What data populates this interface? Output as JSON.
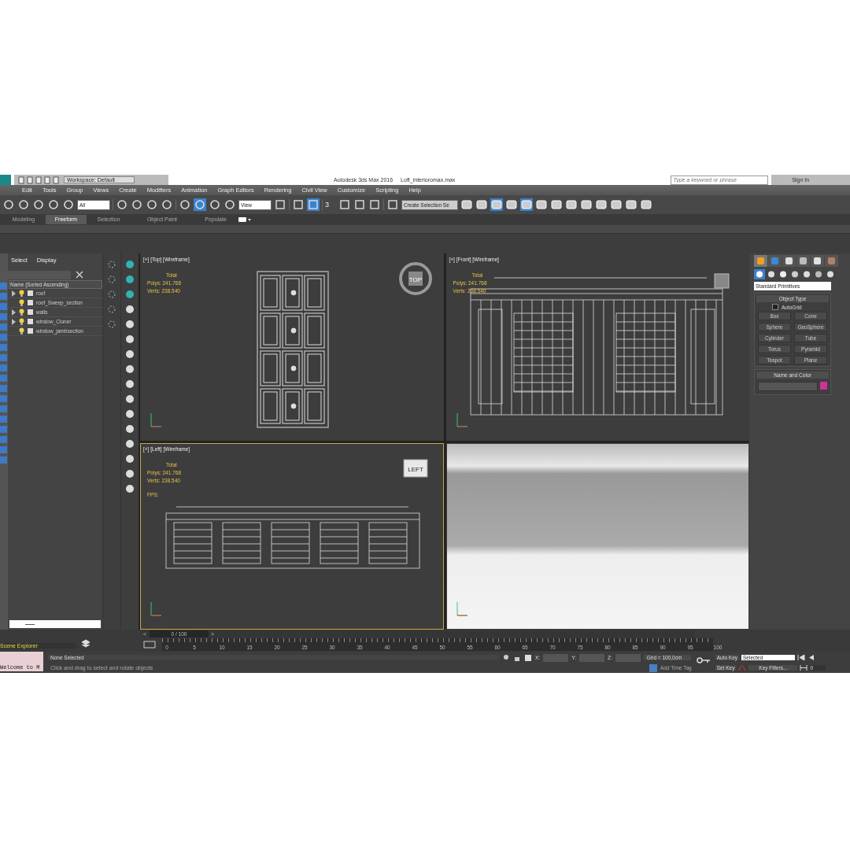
{
  "title_bar": {
    "workspace": "Workspace: Default",
    "title": "Autodesk 3ds Max 2016",
    "file": "Loft_interioromax.max",
    "search": {
      "placeholder": "Type a keyword or phrase"
    },
    "sign_in": "Sign In"
  },
  "menu": [
    "Edit",
    "Tools",
    "Group",
    "Views",
    "Create",
    "Modifiers",
    "Animation",
    "Graph Editors",
    "Rendering",
    "Civil View",
    "Customize",
    "Scripting",
    "Help"
  ],
  "toolbar": {
    "selection_filter": "All",
    "reference_coord": "View",
    "snap_angle": "3",
    "named_selection": "Create Selection Se"
  },
  "ribbon_tabs": [
    {
      "label": "Modeling",
      "selected": false
    },
    {
      "label": "Freeform",
      "selected": true
    },
    {
      "label": "Selection",
      "selected": false
    },
    {
      "label": "Object Paint",
      "selected": false
    },
    {
      "label": "Populate",
      "selected": false
    }
  ],
  "scene_explorer": {
    "tabs": [
      "Select",
      "Display"
    ],
    "column": "Name (Sorted Ascending)",
    "items": [
      {
        "name": "roof",
        "expanded": false
      },
      {
        "name": "roof_Sweep_section"
      },
      {
        "name": "walls",
        "expanded": false
      },
      {
        "name": "window_Cloner",
        "expanded": false
      },
      {
        "name": "window_jambsection"
      }
    ],
    "footer": "Scene Explorer",
    "listener": "Welcome to M"
  },
  "viewports": [
    {
      "kind": "top",
      "label": "[+] [Top] [Wireframe]",
      "active": false,
      "stats": [
        "Total",
        "Polys:",
        "241.768",
        "Verts:",
        "238.540"
      ],
      "cube": "TOP"
    },
    {
      "kind": "front",
      "label": "[+] [Front] [Wireframe]",
      "active": false,
      "stats": [
        "Total",
        "Polys:",
        "241.768",
        "Verts:",
        "238.540"
      ]
    },
    {
      "kind": "left",
      "label": "[+] [Left] [Wireframe]",
      "active": true,
      "stats": [
        "Total",
        "Polys:",
        "241.768",
        "Verts:",
        "238.540"
      ],
      "fps": "FPS:",
      "cube": "LEFT"
    },
    {
      "kind": "perspective",
      "active": false
    }
  ],
  "command_panel": {
    "tabs": [
      {
        "kind": "create",
        "selected": true
      },
      {
        "kind": "modify",
        "selected": false
      },
      {
        "kind": "hierarchy",
        "selected": false
      },
      {
        "kind": "motion",
        "selected": false
      },
      {
        "kind": "display",
        "selected": false
      },
      {
        "kind": "utilities",
        "selected": false
      }
    ],
    "categories": [
      {
        "kind": "geometry",
        "selected": true
      },
      {
        "kind": "shapes",
        "selected": false
      },
      {
        "kind": "lights",
        "selected": false
      },
      {
        "kind": "cameras",
        "selected": false
      },
      {
        "kind": "helpers",
        "selected": false
      },
      {
        "kind": "spacewarps",
        "selected": false
      },
      {
        "kind": "systems",
        "selected": false
      }
    ],
    "dropdown": "Standard Primitives",
    "object_type": {
      "title": "Object Type",
      "autogrid": {
        "label": "AutoGrid",
        "checked": false
      },
      "buttons": [
        "Box",
        "Cone",
        "Sphere",
        "GeoSphere",
        "Cylinder",
        "Tube",
        "Torus",
        "Pyramid",
        "Teapot",
        "Plane"
      ]
    },
    "name_and_color": {
      "title": "Name and Color",
      "color": "#cc3399"
    }
  },
  "timeline": {
    "slider": "0 / 100",
    "level": 0,
    "prev": "<",
    "next": ">",
    "ruler": [
      "0",
      "5",
      "10",
      "15",
      "20",
      "25",
      "30",
      "35",
      "40",
      "45",
      "50",
      "55",
      "60",
      "65",
      "70",
      "75",
      "80",
      "85",
      "90",
      "95",
      "100"
    ]
  },
  "status": {
    "selection": "None Selected",
    "prompt": "Click and drag to select and rotate objects",
    "x": "X:",
    "y": "Y:",
    "z": "Z:",
    "grid": "Grid = 100,0cm",
    "time_tag": "Add Time Tag",
    "auto_key": "Auto Key",
    "key_mode": "Selected",
    "set_key": "Set Key",
    "key_filters": "Key Filters...",
    "frame": "0"
  }
}
